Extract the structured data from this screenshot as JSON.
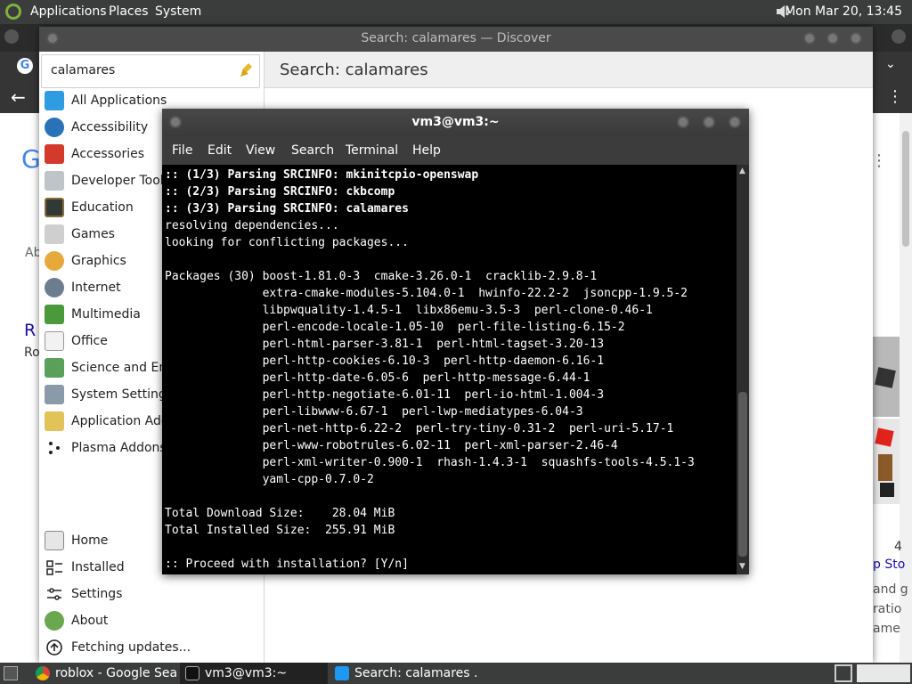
{
  "top_panel": {
    "menus": [
      "Applications",
      "Places",
      "System"
    ],
    "clock": "Mon Mar 20, 13:45"
  },
  "discover": {
    "title": "Search: calamares — Discover",
    "search_value": "calamares",
    "header": "Search: calamares",
    "categories": [
      {
        "label": "All Applications",
        "icon": "grid-icon"
      },
      {
        "label": "Accessibility",
        "icon": "accessibility-icon"
      },
      {
        "label": "Accessories",
        "icon": "knife-icon"
      },
      {
        "label": "Developer Tools",
        "icon": "tools-icon"
      },
      {
        "label": "Education",
        "icon": "chalkboard-icon"
      },
      {
        "label": "Games",
        "icon": "chess-icon"
      },
      {
        "label": "Graphics",
        "icon": "palette-icon"
      },
      {
        "label": "Internet",
        "icon": "globe-icon"
      },
      {
        "label": "Multimedia",
        "icon": "film-icon"
      },
      {
        "label": "Office",
        "icon": "document-icon"
      },
      {
        "label": "Science and Eng",
        "icon": "flask-icon"
      },
      {
        "label": "System Settings",
        "icon": "wrench-icon"
      },
      {
        "label": "Application Addo",
        "icon": "addon-icon"
      },
      {
        "label": "Plasma Addons",
        "icon": "plasma-icon"
      }
    ],
    "bottom_nav": [
      {
        "label": "Home",
        "icon": "home-icon"
      },
      {
        "label": "Installed",
        "icon": "installed-icon"
      },
      {
        "label": "Settings",
        "icon": "settings-icon"
      },
      {
        "label": "About",
        "icon": "about-icon"
      },
      {
        "label": "Fetching updates...",
        "icon": "update-icon"
      }
    ]
  },
  "terminal": {
    "title": "vm3@vm3:~",
    "menu": [
      "File",
      "Edit",
      "View",
      "Search",
      "Terminal",
      "Help"
    ],
    "lines": [
      {
        "text": ":: (1/3) Parsing SRCINFO: mkinitcpio-openswap",
        "bold": true
      },
      {
        "text": ":: (2/3) Parsing SRCINFO: ckbcomp",
        "bold": true
      },
      {
        "text": ":: (3/3) Parsing SRCINFO: calamares",
        "bold": true
      },
      {
        "text": "resolving dependencies...",
        "bold": false
      },
      {
        "text": "looking for conflicting packages...",
        "bold": false
      },
      {
        "text": "",
        "bold": false
      },
      {
        "text": "Packages (30) boost-1.81.0-3  cmake-3.26.0-1  cracklib-2.9.8-1",
        "bold": false
      },
      {
        "text": "              extra-cmake-modules-5.104.0-1  hwinfo-22.2-2  jsoncpp-1.9.5-2",
        "bold": false
      },
      {
        "text": "              libpwquality-1.4.5-1  libx86emu-3.5-3  perl-clone-0.46-1",
        "bold": false
      },
      {
        "text": "              perl-encode-locale-1.05-10  perl-file-listing-6.15-2",
        "bold": false
      },
      {
        "text": "              perl-html-parser-3.81-1  perl-html-tagset-3.20-13",
        "bold": false
      },
      {
        "text": "              perl-http-cookies-6.10-3  perl-http-daemon-6.16-1",
        "bold": false
      },
      {
        "text": "              perl-http-date-6.05-6  perl-http-message-6.44-1",
        "bold": false
      },
      {
        "text": "              perl-http-negotiate-6.01-11  perl-io-html-1.004-3",
        "bold": false
      },
      {
        "text": "              perl-libwww-6.67-1  perl-lwp-mediatypes-6.04-3",
        "bold": false
      },
      {
        "text": "              perl-net-http-6.22-2  perl-try-tiny-0.31-2  perl-uri-5.17-1",
        "bold": false
      },
      {
        "text": "              perl-www-robotrules-6.02-11  perl-xml-parser-2.46-4",
        "bold": false
      },
      {
        "text": "              perl-xml-writer-0.900-1  rhash-1.4.3-1  squashfs-tools-4.5.1-3",
        "bold": false
      },
      {
        "text": "              yaml-cpp-0.7.0-2",
        "bold": false
      },
      {
        "text": "",
        "bold": false
      },
      {
        "text": "Total Download Size:    28.04 MiB",
        "bold": false
      },
      {
        "text": "Total Installed Size:  255.91 MiB",
        "bold": false
      },
      {
        "text": "",
        "bold": false
      },
      {
        "text": ":: Proceed with installation? [Y/n]",
        "bold": false
      }
    ]
  },
  "chrome_bg": {
    "fragments": [
      "G",
      "Ab",
      "R",
      "Ro",
      "4",
      "p Sto",
      "and g",
      "ratio",
      "ame"
    ]
  },
  "taskbar": {
    "tasks": [
      {
        "label": "roblox - Google Sea...",
        "icon": "chrome-icon"
      },
      {
        "label": "vm3@vm3:~",
        "icon": "terminal-icon"
      },
      {
        "label": "Search: calamares ...",
        "icon": "discover-icon"
      }
    ]
  }
}
